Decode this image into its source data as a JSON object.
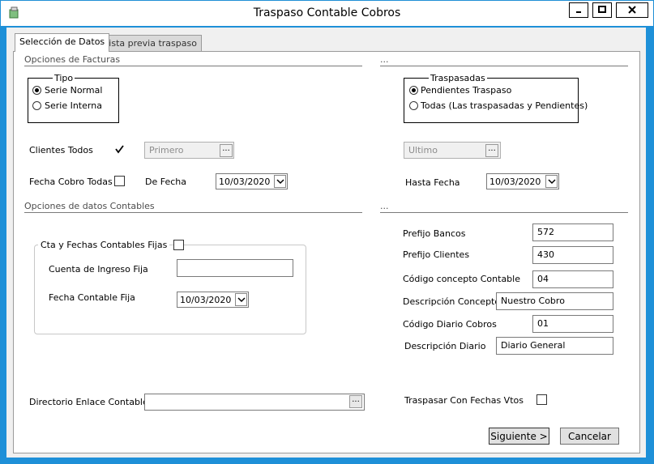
{
  "window": {
    "title": "Traspaso Contable Cobros"
  },
  "tabs": [
    {
      "label": "Selección de Datos",
      "active": true
    },
    {
      "label": "Vista previa traspaso",
      "active": false
    }
  ],
  "facturas": {
    "title": "Opciones de Facturas",
    "right_title": "...",
    "tipo": {
      "title": "Tipo",
      "options": [
        {
          "label": "Serie Normal",
          "checked": true
        },
        {
          "label": "Serie Interna",
          "checked": false
        }
      ]
    },
    "traspasadas": {
      "title": "Traspasadas",
      "options": [
        {
          "label": "Pendientes Traspaso",
          "checked": true
        },
        {
          "label": "Todas (Las traspasadas y Pendientes)",
          "checked": false
        }
      ]
    },
    "clientes_todos_label": "Clientes Todos",
    "clientes_todos_checked": true,
    "cliente_desde": "Primero",
    "cliente_hasta": "Ultimo",
    "fecha_cobro_todas_label": "Fecha Cobro Todas",
    "fecha_cobro_todas_checked": false,
    "de_fecha_label": "De Fecha",
    "de_fecha_value": "10/03/2020",
    "hasta_fecha_label": "Hasta Fecha",
    "hasta_fecha_value": "10/03/2020"
  },
  "contables": {
    "title": "Opciones de datos Contables",
    "right_title": "...",
    "cta_fechas_label": "Cta y Fechas Contables Fijas",
    "cta_fechas_checked": false,
    "cuenta_ingreso_label": "Cuenta de Ingreso Fija",
    "cuenta_ingreso_value": "",
    "fecha_contable_label": "Fecha Contable Fija",
    "fecha_contable_value": "10/03/2020",
    "fields": [
      {
        "label": "Prefijo Bancos",
        "value": "572"
      },
      {
        "label": "Prefijo Clientes",
        "value": "430"
      },
      {
        "label": "Código concepto Contable",
        "value": "04"
      },
      {
        "label": "Descripción Concepto",
        "value": "Nuestro Cobro"
      },
      {
        "label": "Código Diario Cobros",
        "value": "01"
      },
      {
        "label": "Descripción Diario",
        "value": "Diario General"
      }
    ]
  },
  "directorio": {
    "label": "Directorio Enlace Contable",
    "value": "",
    "browse_label": "..."
  },
  "traspasar_vtos": {
    "label": "Traspasar Con Fechas Vtos",
    "checked": false
  },
  "buttons": {
    "next": "Siguiente >",
    "cancel": "Cancelar"
  },
  "colors": {
    "frame": "#1e90d8",
    "panel": "#ffffff",
    "client": "#f0f0f0"
  }
}
